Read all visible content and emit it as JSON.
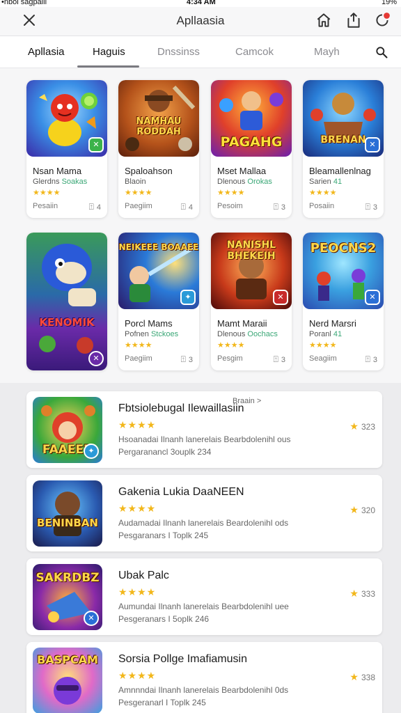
{
  "status_bar": {
    "left": "•nbol sagpaill",
    "center": "4:34 AM",
    "right": "19%"
  },
  "header": {
    "title": "Apllaasia"
  },
  "tabs": [
    {
      "label": "Apllasia"
    },
    {
      "label": "Haguis"
    },
    {
      "label": "Dnssinss"
    },
    {
      "label": "Camcok"
    },
    {
      "label": "Mayh"
    }
  ],
  "grid": [
    {
      "name": "Nsan Mama",
      "sub_a": "Glerdns",
      "sub_b": "Soakas",
      "stars": "★★★★",
      "footer": "Pesaiin",
      "count": "4",
      "art_text": ""
    },
    {
      "name": "Spaloahson",
      "sub_a": "Blaoin",
      "sub_b": "",
      "stars": "★★★★",
      "footer": "Paegiim",
      "count": "4",
      "art_text": "NAMHAU RODDAH"
    },
    {
      "name": "Mset Mallaa",
      "sub_a": "Dlenous",
      "sub_b": "Orokas",
      "stars": "★★★★",
      "footer": "Pesoim",
      "count": "3",
      "art_text": "PAGAHG"
    },
    {
      "name": "Bleamallenlnag",
      "sub_a": "Sarien",
      "sub_b": "41",
      "stars": "★★★★",
      "footer": "Posaiin",
      "count": "3",
      "art_text": "BRENAN"
    },
    {
      "name": "",
      "sub_a": "",
      "sub_b": "",
      "stars": "",
      "footer": "",
      "count": "",
      "art_text": "KENOMIK"
    },
    {
      "name": "Porcl Mams",
      "sub_a": "Pofnen",
      "sub_b": "Stckoes",
      "stars": "★★★★",
      "footer": "Paegiim",
      "count": "3",
      "art_text": "NEIKEEE BOAAEE"
    },
    {
      "name": "Mamt Maraii",
      "sub_a": "Dlenous",
      "sub_b": "Oochacs",
      "stars": "★★★★",
      "footer": "Pesgim",
      "count": "3",
      "art_text": "NANISHL BHEKEIH"
    },
    {
      "name": "Nerd Marsri",
      "sub_a": "Poranl",
      "sub_b": "41",
      "stars": "★★★★",
      "footer": "Seagiim",
      "count": "3",
      "art_text": "PEOCNS2"
    }
  ],
  "list": [
    {
      "title": "Fbtsiolebugal Ilewaillasiin",
      "more": "Braain >",
      "stars": "★★★★",
      "desc": "Hsoanadai Ilnanh lanerelais Bearbdolenihl ous",
      "meta": "Pergaranancl 3ouplk 234",
      "score": "323",
      "thumb_text": "FAAEEB"
    },
    {
      "title": "Gakenia Lukia DaaNEEN",
      "more": "",
      "stars": "★★★★",
      "desc": "Audamadai Ilnanh lanerelais Beardolenihl ods",
      "meta": "Pesgaranars I Toplk 245",
      "score": "320",
      "thumb_text": "BENINBAN"
    },
    {
      "title": "Ubak Palc",
      "more": "",
      "stars": "★★★★",
      "desc": "Aumundai Ilnanh lanerelais Bearbdolenihl uee",
      "meta": "Pesgeranars I 5oplk 246",
      "score": "333",
      "thumb_text": "SAKRDBZ"
    },
    {
      "title": "Sorsia Pollge Imafiamusin",
      "more": "",
      "stars": "★★★★",
      "desc": "Amnnndai Ilnanh lanerelais Bearbdolenihl 0ds",
      "meta": "Pesgeranarl I Toplk 245",
      "score": "338",
      "thumb_text": "BASPCAM"
    }
  ],
  "colors": {
    "star": "#f2b71b",
    "accent_green": "#3aa776",
    "badge_blue": "#2a6fd6"
  }
}
